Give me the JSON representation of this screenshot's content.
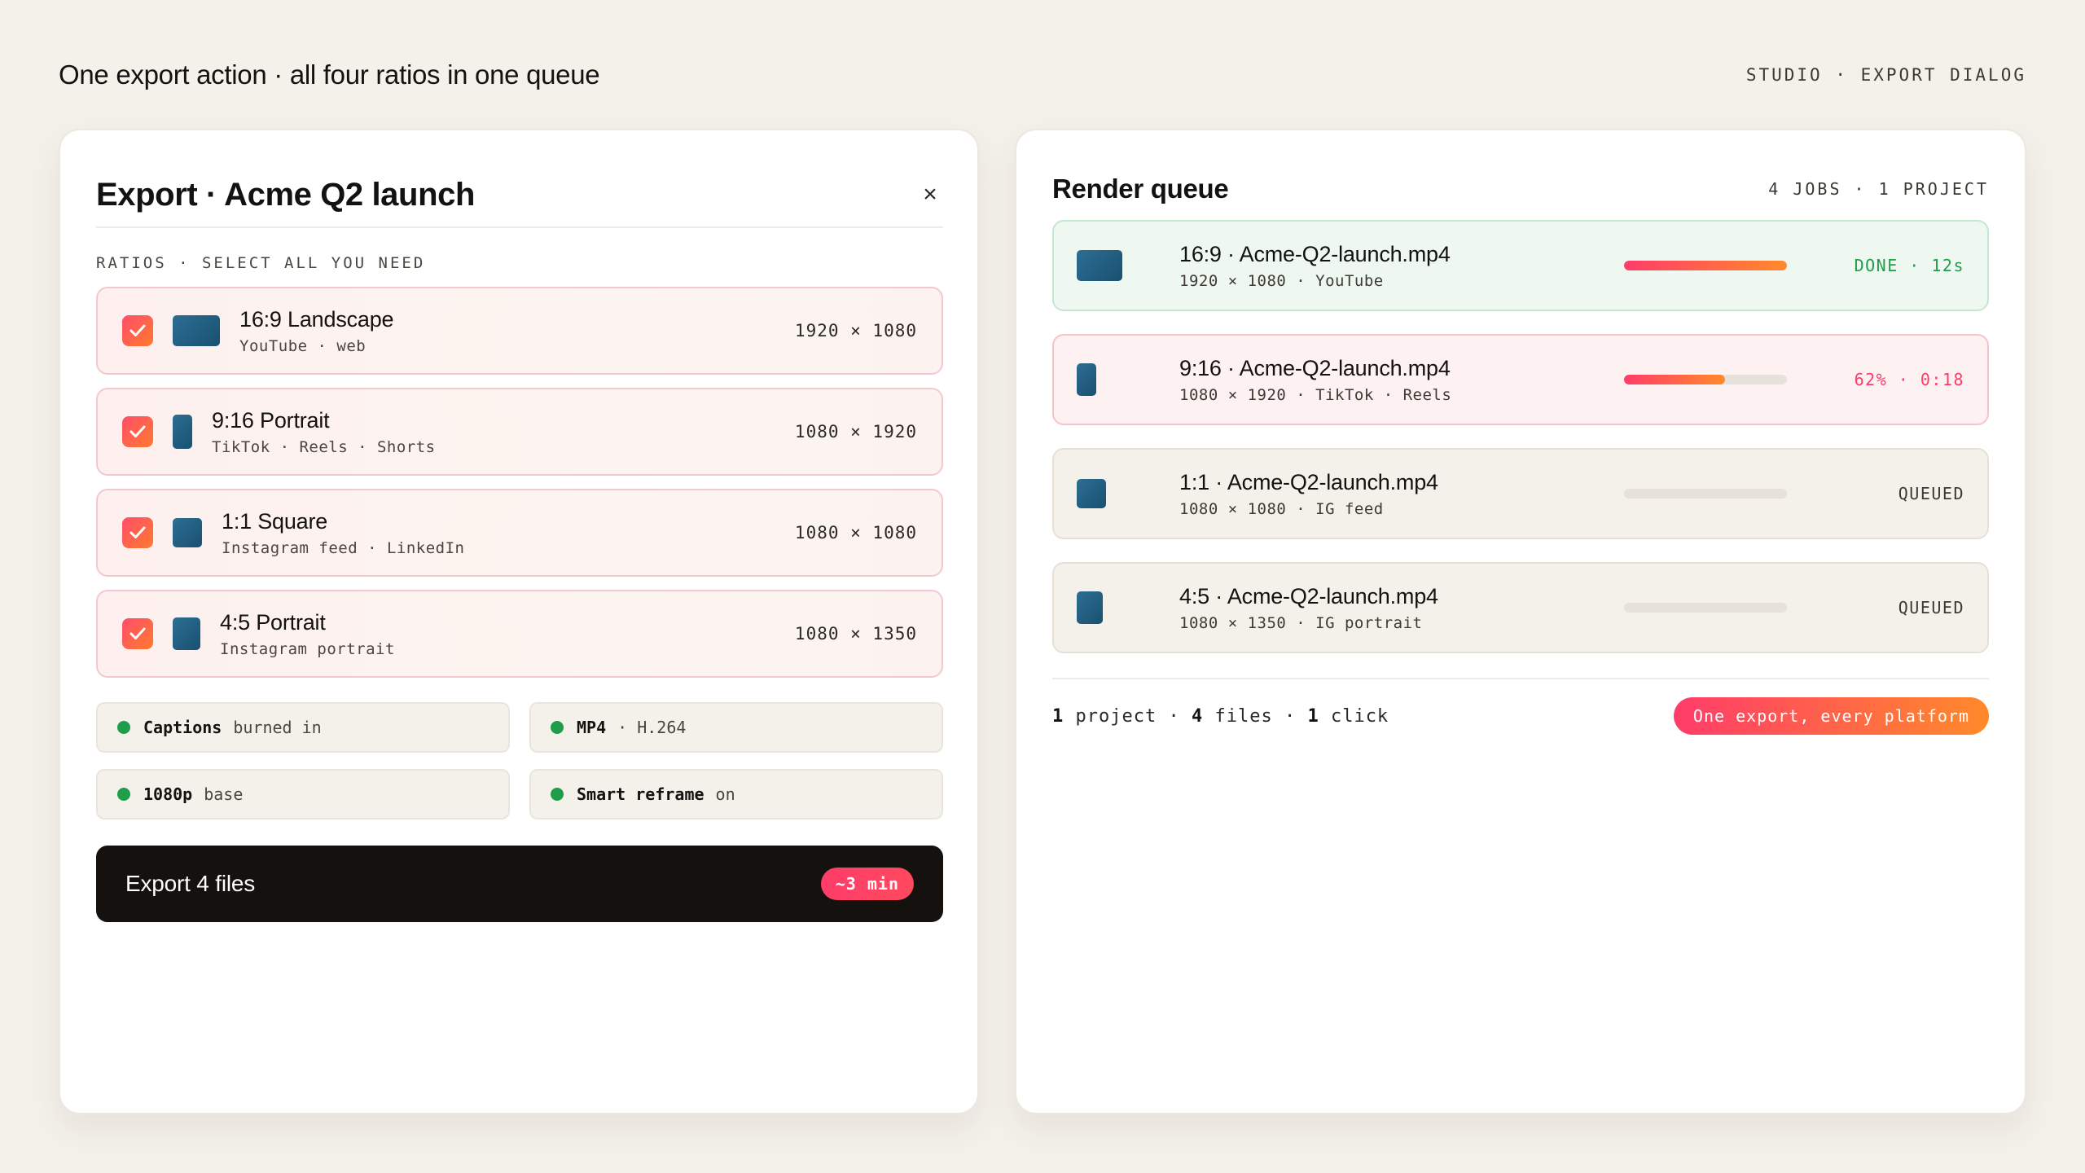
{
  "page": {
    "title": "One export action · all four ratios in one queue",
    "crumb": "STUDIO · EXPORT DIALOG"
  },
  "dialog": {
    "title": "Export · Acme Q2 launch",
    "close_label": "×",
    "section_label": "RATIOS · SELECT ALL YOU NEED",
    "ratios": [
      {
        "name": "16:9 Landscape",
        "sub": "YouTube · web",
        "dims": "1920 × 1080",
        "checked": true
      },
      {
        "name": "9:16 Portrait",
        "sub": "TikTok · Reels · Shorts",
        "dims": "1080 × 1920",
        "checked": true
      },
      {
        "name": "1:1 Square",
        "sub": "Instagram feed · LinkedIn",
        "dims": "1080 × 1080",
        "checked": true
      },
      {
        "name": "4:5 Portrait",
        "sub": "Instagram portrait",
        "dims": "1080 × 1350",
        "checked": true
      }
    ],
    "options": [
      {
        "strong": "Captions",
        "weak": "burned in"
      },
      {
        "strong": "MP4",
        "weak": "· H.264"
      },
      {
        "strong": "1080p",
        "weak": "base"
      },
      {
        "strong": "Smart reframe",
        "weak": "on"
      }
    ],
    "export_label": "Export 4 files",
    "eta": "~3 min"
  },
  "queue": {
    "title": "Render queue",
    "meta": "4 JOBS · 1 PROJECT",
    "jobs": [
      {
        "name": "16:9 · Acme-Q2-launch.mp4",
        "sub": "1920 × 1080 · YouTube",
        "progress": 100,
        "status": "DONE · 12s"
      },
      {
        "name": "9:16 · Acme-Q2-launch.mp4",
        "sub": "1080 × 1920 · TikTok · Reels",
        "progress": 62,
        "status": "62% · 0:18"
      },
      {
        "name": "1:1 · Acme-Q2-launch.mp4",
        "sub": "1080 × 1080 · IG feed",
        "progress": 0,
        "status": "QUEUED"
      },
      {
        "name": "4:5 · Acme-Q2-launch.mp4",
        "sub": "1080 × 1350 · IG portrait",
        "progress": 0,
        "status": "QUEUED"
      }
    ],
    "summary": {
      "projects_count": "1",
      "projects_label": "project",
      "files_count": "4",
      "files_label": "files",
      "clicks_count": "1",
      "clicks_label": "click",
      "separator": "·"
    },
    "tagline": "One export, every platform"
  },
  "colors": {
    "accent": "#ff3c6a",
    "accent_end": "#ff8a2a",
    "success": "#1f9d4a",
    "thumb": "#1f5a7d",
    "background": "#f4f1eb"
  }
}
